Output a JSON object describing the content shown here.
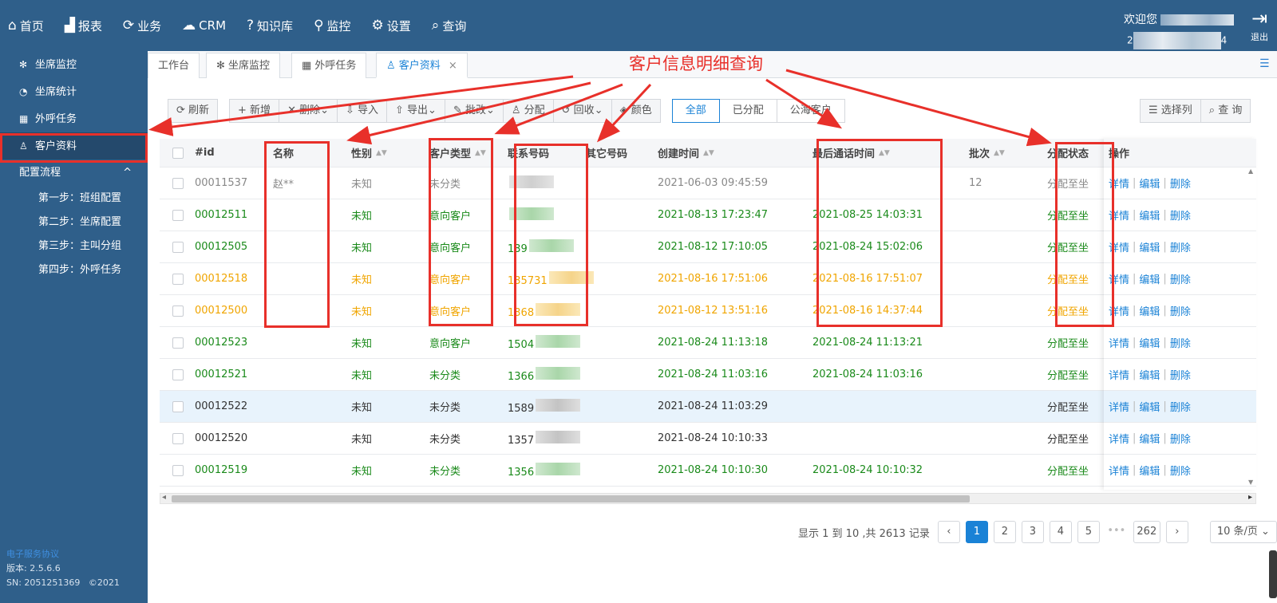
{
  "topnav": [
    {
      "icon": "⌂",
      "label": "首页"
    },
    {
      "icon": "▟",
      "label": "报表"
    },
    {
      "icon": "⟳",
      "label": "业务"
    },
    {
      "icon": "☁",
      "label": "CRM"
    },
    {
      "icon": "?",
      "label": "知识库"
    },
    {
      "icon": "⚲",
      "label": "监控"
    },
    {
      "icon": "⚙",
      "label": "设置"
    },
    {
      "icon": "⌕",
      "label": "查询"
    }
  ],
  "header": {
    "welcome": "欢迎您",
    "userid_prefix": "2",
    "userid_suffix": "4",
    "logout": "退出"
  },
  "sidebar": {
    "items": [
      {
        "icon": "✻",
        "label": "坐席监控"
      },
      {
        "icon": "◔",
        "label": "坐席统计"
      },
      {
        "icon": "▦",
        "label": "外呼任务"
      },
      {
        "icon": "♙",
        "label": "客户资料"
      }
    ],
    "group": {
      "label": "配置流程",
      "chevron": "^"
    },
    "steps": [
      "第一步：班组配置",
      "第二步：坐席配置",
      "第三步：主叫分组",
      "第四步：外呼任务"
    ],
    "footer": {
      "link": "电子服务协议",
      "version": "版本: 2.5.6.6",
      "sn": "SN: 2051251369",
      "copyright": "©2021"
    }
  },
  "tabs": [
    {
      "label": "工作台"
    },
    {
      "label": "✻  坐席监控"
    },
    {
      "label": "▦  外呼任务"
    },
    {
      "label": "♙  客户资料",
      "close": "×"
    }
  ],
  "annotation": {
    "title": "客户信息明细查询",
    "color": "#e8302a"
  },
  "toolbar": {
    "refresh": "⟳ 刷新",
    "group": [
      "+ 新增",
      "✕ 删除⌄",
      "⇩ 导入",
      "⇧ 导出⌄",
      "✎ 批改⌄",
      "♙ 分配",
      "↺ 回收⌄",
      "◈ 颜色"
    ],
    "filters": [
      "全部",
      "已分配",
      "公海客户"
    ],
    "columns": "☰ 选择列",
    "query": "⌕ 查 询"
  },
  "table": {
    "headers": {
      "id": "#id",
      "name": "名称",
      "gender": "性别",
      "type": "客户类型",
      "phone": "联系号码",
      "other": "其它号码",
      "created": "创建时间",
      "last_call": "最后通话时间",
      "batch": "批次",
      "assign": "分配状态",
      "ops": "操作"
    },
    "rows": [
      {
        "id": "00011537",
        "name": "赵**",
        "gender": "未知",
        "type": "未分类",
        "phone": "",
        "created": "2021-06-03 09:45:59",
        "last_call": "",
        "batch": "12",
        "assign": "分配至坐",
        "color": "grey"
      },
      {
        "id": "00012511",
        "name": "",
        "gender": "未知",
        "type": "意向客户",
        "phone": "",
        "created": "2021-08-13 17:23:47",
        "last_call": "2021-08-25 14:03:31",
        "batch": "",
        "assign": "分配至坐",
        "color": "green"
      },
      {
        "id": "00012505",
        "name": "",
        "gender": "未知",
        "type": "意向客户",
        "phone": "139",
        "created": "2021-08-12 17:10:05",
        "last_call": "2021-08-24 15:02:06",
        "batch": "",
        "assign": "分配至坐",
        "color": "green"
      },
      {
        "id": "00012518",
        "name": "",
        "gender": "未知",
        "type": "意向客户",
        "phone": "135731",
        "created": "2021-08-16 17:51:06",
        "last_call": "2021-08-16 17:51:07",
        "batch": "",
        "assign": "分配至坐",
        "color": "yellow"
      },
      {
        "id": "00012500",
        "name": "",
        "gender": "未知",
        "type": "意向客户",
        "phone": "1368",
        "created": "2021-08-12 13:51:16",
        "last_call": "2021-08-16 14:37:44",
        "batch": "",
        "assign": "分配至坐",
        "color": "yellow"
      },
      {
        "id": "00012523",
        "name": "",
        "gender": "未知",
        "type": "意向客户",
        "phone": "1504",
        "created": "2021-08-24 11:13:18",
        "last_call": "2021-08-24 11:13:21",
        "batch": "",
        "assign": "分配至坐",
        "color": "green"
      },
      {
        "id": "00012521",
        "name": "",
        "gender": "未知",
        "type": "未分类",
        "phone": "1366",
        "created": "2021-08-24 11:03:16",
        "last_call": "2021-08-24 11:03:16",
        "batch": "",
        "assign": "分配至坐",
        "color": "green"
      },
      {
        "id": "00012522",
        "name": "",
        "gender": "未知",
        "type": "未分类",
        "phone": "1589",
        "created": "2021-08-24 11:03:29",
        "last_call": "",
        "batch": "",
        "assign": "分配至坐",
        "color": "dark"
      },
      {
        "id": "00012520",
        "name": "",
        "gender": "未知",
        "type": "未分类",
        "phone": "1357",
        "created": "2021-08-24 10:10:33",
        "last_call": "",
        "batch": "",
        "assign": "分配至坐",
        "color": "dark"
      },
      {
        "id": "00012519",
        "name": "",
        "gender": "未知",
        "type": "未分类",
        "phone": "1356",
        "created": "2021-08-24 10:10:30",
        "last_call": "2021-08-24 10:10:32",
        "batch": "",
        "assign": "分配至坐",
        "color": "green"
      }
    ],
    "ops": {
      "detail": "详情",
      "edit": "编辑",
      "delete": "删除",
      "sep": "|"
    }
  },
  "pagination": {
    "info": "显示 1 到 10 ,共 2613 记录",
    "prev": "‹",
    "next": "›",
    "pages": [
      "1",
      "2",
      "3",
      "4",
      "5"
    ],
    "dots": "•••",
    "last": "262",
    "page_size": "10 条/页 ⌄"
  },
  "menu_icon": "☰",
  "scroll_arrows": {
    "up": "▲",
    "down": "▼",
    "left": "◂",
    "right": "▸"
  }
}
